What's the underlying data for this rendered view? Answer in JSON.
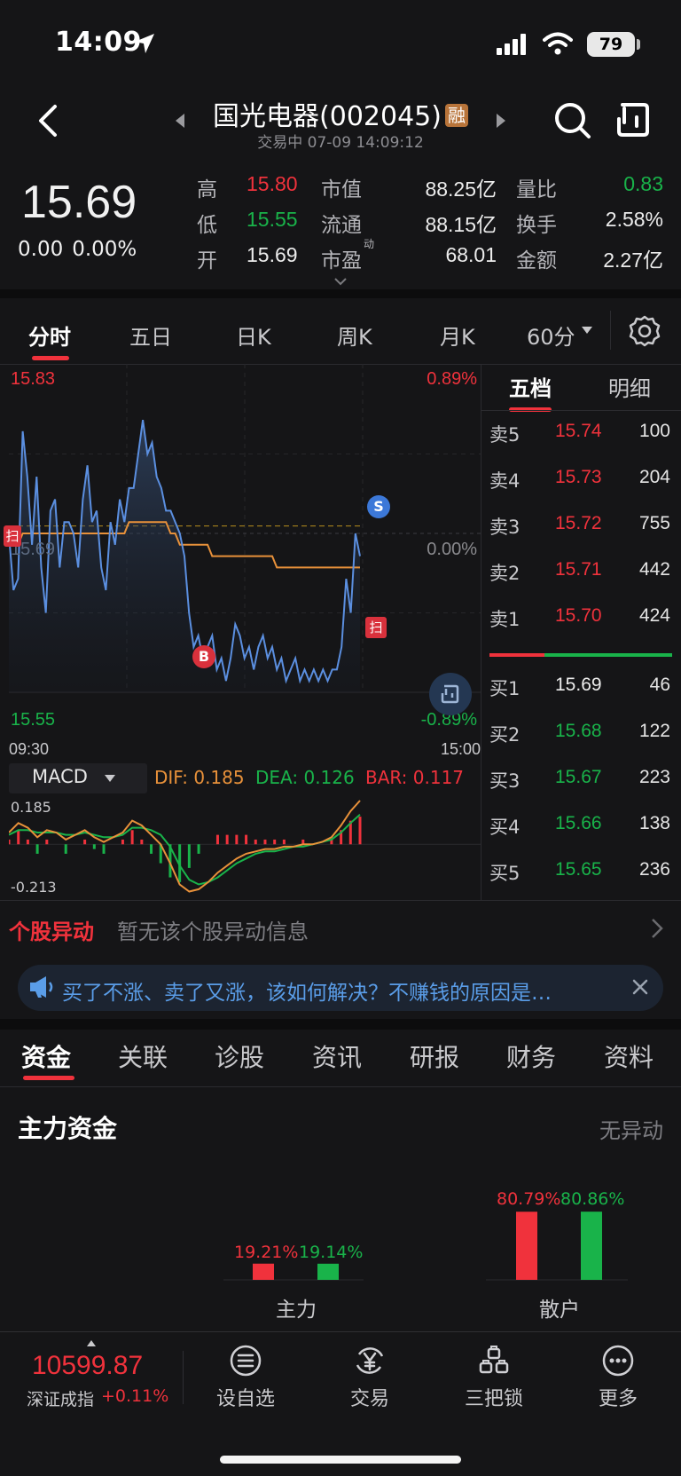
{
  "status_bar": {
    "time": "14:09",
    "battery": "79"
  },
  "header": {
    "title": "国光电器(002045)",
    "badge": "融",
    "subtitle": "交易中 07-09 14:09:12"
  },
  "quote": {
    "price": "15.69",
    "change": "0.00",
    "change_pct": "0.00%",
    "rows": [
      {
        "l1": "高",
        "v1": "15.80",
        "l2": "市值",
        "v2": "88.25亿",
        "l3": "量比",
        "v3": "0.83"
      },
      {
        "l1": "低",
        "v1": "15.55",
        "l2": "流通",
        "v2": "88.15亿",
        "l3": "换手",
        "v3": "2.58%"
      },
      {
        "l1": "开",
        "v1": "15.69",
        "l2": "市盈",
        "v2": "68.01",
        "l3": "金额",
        "v3": "2.27亿"
      }
    ],
    "pe_sup": "动"
  },
  "chart_tabs": [
    "分时",
    "五日",
    "日K",
    "周K",
    "月K",
    "60分"
  ],
  "chart_data": {
    "type": "line",
    "y_left_top": "15.83",
    "y_left_mid": "15.69",
    "y_left_bottom": "15.55",
    "y_right_top": "0.89%",
    "y_right_mid": "0.00%",
    "y_right_bottom": "-0.89%",
    "x_start": "09:30",
    "x_end": "15:00",
    "ylim": [
      15.55,
      15.83
    ],
    "prev_close": 15.69,
    "markers": {
      "buy": "B",
      "sell": "S",
      "scan": "扫"
    },
    "price_series": [
      15.69,
      15.64,
      15.65,
      15.78,
      15.74,
      15.68,
      15.74,
      15.66,
      15.62,
      15.71,
      15.72,
      15.66,
      15.7,
      15.7,
      15.69,
      15.66,
      15.72,
      15.75,
      15.7,
      15.71,
      15.66,
      15.64,
      15.7,
      15.68,
      15.72,
      15.7,
      15.73,
      15.73,
      15.76,
      15.79,
      15.76,
      15.77,
      15.74,
      15.73,
      15.71,
      15.71,
      15.7,
      15.69,
      15.67,
      15.62,
      15.59,
      15.6,
      15.58,
      15.59,
      15.6,
      15.57,
      15.58,
      15.56,
      15.58,
      15.61,
      15.6,
      15.58,
      15.59,
      15.57,
      15.59,
      15.6,
      15.58,
      15.59,
      15.57,
      15.58,
      15.56,
      15.57,
      15.58,
      15.56,
      15.57,
      15.56,
      15.57,
      15.56,
      15.57,
      15.56,
      15.57,
      15.57,
      15.59,
      15.65,
      15.62,
      15.69,
      15.67
    ],
    "avg_series": [
      15.69,
      15.68,
      15.68,
      15.69,
      15.69,
      15.69,
      15.69,
      15.69,
      15.69,
      15.69,
      15.69,
      15.69,
      15.69,
      15.69,
      15.69,
      15.69,
      15.69,
      15.69,
      15.69,
      15.69,
      15.69,
      15.69,
      15.69,
      15.69,
      15.69,
      15.69,
      15.7,
      15.7,
      15.7,
      15.7,
      15.7,
      15.7,
      15.7,
      15.7,
      15.7,
      15.69,
      15.69,
      15.68,
      15.68,
      15.68,
      15.68,
      15.68,
      15.68,
      15.68,
      15.67,
      15.67,
      15.67,
      15.67,
      15.67,
      15.67,
      15.67,
      15.67,
      15.67,
      15.67,
      15.67,
      15.67,
      15.67,
      15.67,
      15.66,
      15.66,
      15.66,
      15.66,
      15.66,
      15.66,
      15.66,
      15.66,
      15.66,
      15.66,
      15.66,
      15.66,
      15.66,
      15.66,
      15.66,
      15.66,
      15.66,
      15.66,
      15.66
    ]
  },
  "macd": {
    "label": "MACD",
    "dif": "DIF: 0.185",
    "dea": "DEA: 0.126",
    "bar": "BAR: 0.117",
    "max_label": "0.185",
    "min_label": "-0.213",
    "ylim": [
      -0.213,
      0.185
    ],
    "dif_series": [
      0.05,
      0.09,
      0.07,
      0.03,
      0.06,
      0.05,
      0.02,
      0.04,
      0.06,
      0.03,
      0.01,
      0.03,
      0.05,
      0.1,
      0.08,
      0.04,
      0.0,
      -0.08,
      -0.17,
      -0.2,
      -0.19,
      -0.16,
      -0.12,
      -0.09,
      -0.06,
      -0.04,
      -0.03,
      -0.02,
      -0.02,
      -0.01,
      -0.01,
      0.0,
      0.0,
      0.01,
      0.03,
      0.08,
      0.14,
      0.185
    ],
    "dea_series": [
      0.04,
      0.06,
      0.06,
      0.05,
      0.05,
      0.05,
      0.04,
      0.04,
      0.05,
      0.04,
      0.03,
      0.03,
      0.04,
      0.07,
      0.07,
      0.06,
      0.04,
      -0.01,
      -0.09,
      -0.15,
      -0.17,
      -0.16,
      -0.14,
      -0.11,
      -0.08,
      -0.06,
      -0.04,
      -0.03,
      -0.03,
      -0.02,
      -0.01,
      -0.01,
      0.0,
      0.01,
      0.02,
      0.05,
      0.09,
      0.126
    ],
    "bar_series": [
      0.02,
      0.06,
      0.02,
      -0.04,
      0.02,
      0.0,
      -0.04,
      0.0,
      0.02,
      -0.02,
      -0.04,
      0.0,
      0.02,
      0.06,
      0.02,
      -0.04,
      -0.08,
      -0.14,
      -0.16,
      -0.1,
      -0.04,
      0.0,
      0.04,
      0.04,
      0.04,
      0.04,
      0.02,
      0.02,
      0.02,
      0.02,
      0.0,
      0.02,
      0.0,
      0.0,
      0.02,
      0.06,
      0.1,
      0.117
    ]
  },
  "orderbook": {
    "tabs": [
      "五档",
      "明细"
    ],
    "asks": [
      {
        "label": "卖5",
        "price": "15.74",
        "vol": "100"
      },
      {
        "label": "卖4",
        "price": "15.73",
        "vol": "204"
      },
      {
        "label": "卖3",
        "price": "15.72",
        "vol": "755"
      },
      {
        "label": "卖2",
        "price": "15.71",
        "vol": "442"
      },
      {
        "label": "卖1",
        "price": "15.70",
        "vol": "424"
      }
    ],
    "bids": [
      {
        "label": "买1",
        "price": "15.69",
        "vol": "46"
      },
      {
        "label": "买2",
        "price": "15.68",
        "vol": "122"
      },
      {
        "label": "买3",
        "price": "15.67",
        "vol": "223"
      },
      {
        "label": "买4",
        "price": "15.66",
        "vol": "138"
      },
      {
        "label": "买5",
        "price": "15.65",
        "vol": "236"
      }
    ]
  },
  "anomaly": {
    "title": "个股异动",
    "text": "暂无该个股异动信息"
  },
  "banner": {
    "text": "买了不涨、卖了又涨，该如何解决？不赚钱的原因是…"
  },
  "section_tabs": [
    "资金",
    "关联",
    "诊股",
    "资讯",
    "研报",
    "财务",
    "资料"
  ],
  "fund": {
    "title": "主力资金",
    "status": "无异动",
    "main_label": "主力",
    "main_in": "19.21%",
    "main_out": "19.14%",
    "retail_label": "散户",
    "retail_in": "80.79%",
    "retail_out": "80.86%",
    "values": {
      "main_in": 19.21,
      "main_out": 19.14,
      "retail_in": 80.79,
      "retail_out": 80.86
    }
  },
  "bottom_bar": {
    "index_value": "10599.87",
    "index_name": "深证成指",
    "index_change": "+0.11%",
    "nav": [
      "设自选",
      "交易",
      "三把锁",
      "更多"
    ]
  },
  "colors": {
    "up": "#f0323c",
    "down": "#19b34a",
    "price_line": "#5b8fe0",
    "avg_line": "#e8913a"
  }
}
